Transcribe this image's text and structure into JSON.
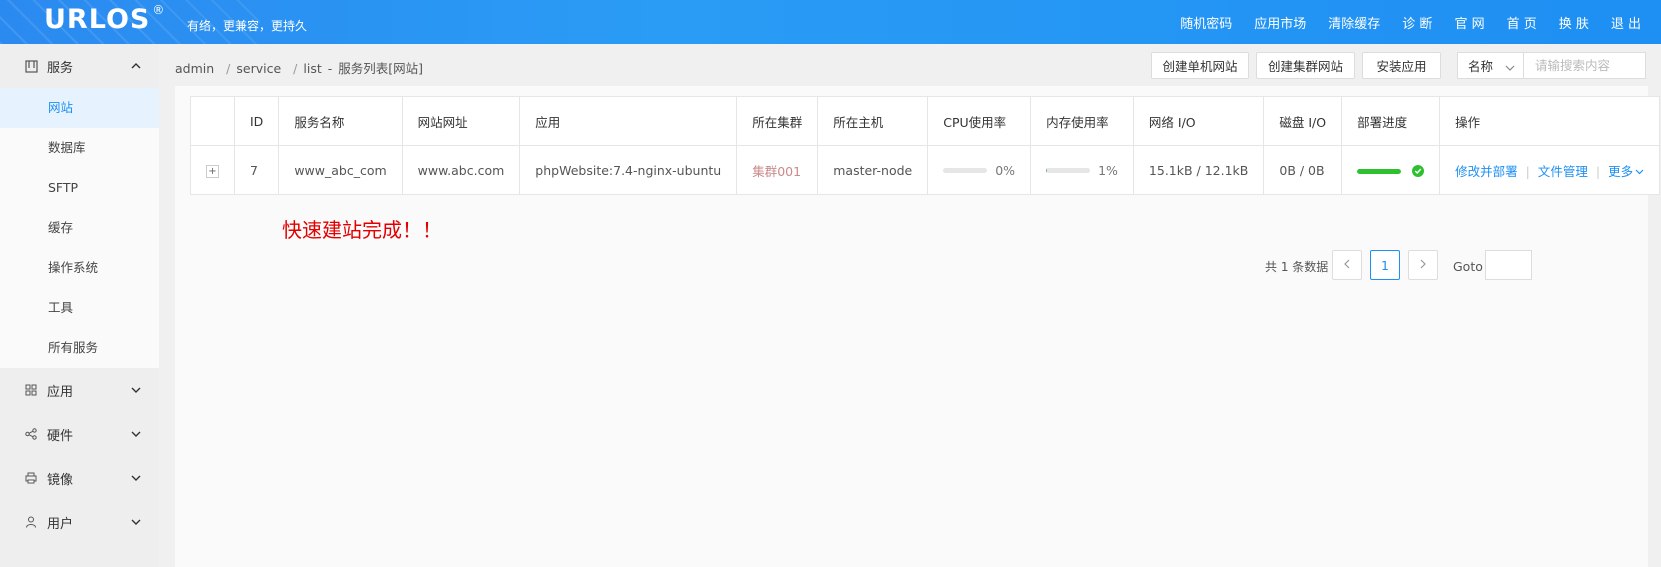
{
  "header": {
    "logo": "URLOS",
    "logo_mark": "®",
    "slogan": "有络，更兼容，更持久",
    "nav": [
      "随机密码",
      "应用市场",
      "清除缓存",
      "诊 断",
      "官 网",
      "首 页",
      "换 肤",
      "退 出"
    ]
  },
  "sidebar": {
    "groups": [
      {
        "label": "服务",
        "icon": "service-icon",
        "expanded": true,
        "items": [
          "网站",
          "数据库",
          "SFTP",
          "缓存",
          "操作系统",
          "工具",
          "所有服务"
        ],
        "active_item": "网站"
      },
      {
        "label": "应用",
        "icon": "grid-icon"
      },
      {
        "label": "硬件",
        "icon": "share-icon"
      },
      {
        "label": "镜像",
        "icon": "printer-icon"
      },
      {
        "label": "用户",
        "icon": "user-icon"
      }
    ]
  },
  "breadcrumb": {
    "parts": [
      "admin",
      "service",
      "list"
    ],
    "dash": "-",
    "current": "服务列表[网站]"
  },
  "toolbar": {
    "create_single": "创建单机网站",
    "create_cluster": "创建集群网站",
    "install_app": "安装应用",
    "search_field": "名称",
    "search_placeholder": "请输搜索内容",
    "search_value": ""
  },
  "table": {
    "headers": [
      "",
      "ID",
      "服务名称",
      "网站网址",
      "应用",
      "所在集群",
      "所在主机",
      "CPU使用率",
      "内存使用率",
      "网络 I/O",
      "磁盘 I/O",
      "部署进度",
      "操作"
    ],
    "rows": [
      {
        "expand": "+",
        "id": "7",
        "service_name": "www_abc_com",
        "url": "www.abc.com",
        "app": "phpWebsite:7.4-nginx-ubuntu",
        "cluster": "集群001",
        "host": "master-node",
        "cpu_pct": 0,
        "cpu_label": "0%",
        "mem_pct": 1,
        "mem_label": "1%",
        "net_io": "15.1kB / 12.1kB",
        "disk_io": "0B / 0B",
        "deploy_pct": 100,
        "actions": [
          "修改并部署",
          "文件管理",
          "更多"
        ]
      }
    ]
  },
  "notice": "快速建站完成！！",
  "pager": {
    "total": "共 1 条数据",
    "current": "1",
    "goto_label": "Goto",
    "goto_value": ""
  },
  "colors": {
    "header_blue": "#1e8ff3",
    "link_blue": "#1e8ff3",
    "notice_red": "#e10000",
    "deploy_green": "#2ec02e"
  }
}
